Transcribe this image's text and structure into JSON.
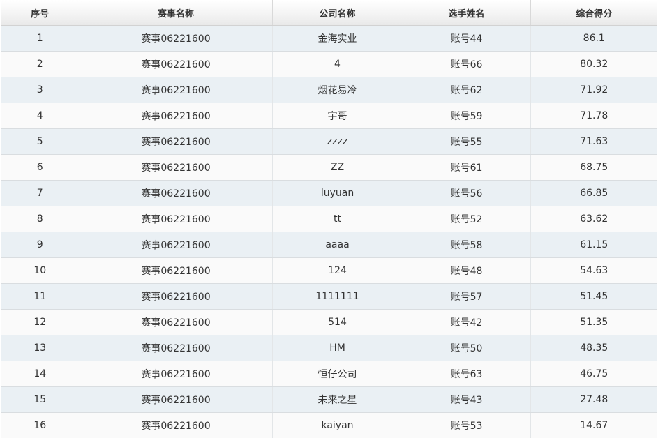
{
  "table": {
    "columns": [
      "序号",
      "赛事名称",
      "公司名称",
      "选手姓名",
      "综合得分"
    ],
    "rows": [
      [
        "1",
        "赛事06221600",
        "金海实业",
        "账号44",
        "86.1"
      ],
      [
        "2",
        "赛事06221600",
        "4",
        "账号66",
        "80.32"
      ],
      [
        "3",
        "赛事06221600",
        "烟花易冷",
        "账号62",
        "71.92"
      ],
      [
        "4",
        "赛事06221600",
        "宇哥",
        "账号59",
        "71.78"
      ],
      [
        "5",
        "赛事06221600",
        "zzzz",
        "账号55",
        "71.63"
      ],
      [
        "6",
        "赛事06221600",
        "ZZ",
        "账号61",
        "68.75"
      ],
      [
        "7",
        "赛事06221600",
        "luyuan",
        "账号56",
        "66.85"
      ],
      [
        "8",
        "赛事06221600",
        "tt",
        "账号52",
        "63.62"
      ],
      [
        "9",
        "赛事06221600",
        "aaaa",
        "账号58",
        "61.15"
      ],
      [
        "10",
        "赛事06221600",
        "124",
        "账号48",
        "54.63"
      ],
      [
        "11",
        "赛事06221600",
        "1111111",
        "账号57",
        "51.45"
      ],
      [
        "12",
        "赛事06221600",
        "514",
        "账号42",
        "51.35"
      ],
      [
        "13",
        "赛事06221600",
        "HM",
        "账号50",
        "48.35"
      ],
      [
        "14",
        "赛事06221600",
        "恒仔公司",
        "账号63",
        "46.75"
      ],
      [
        "15",
        "赛事06221600",
        "未来之星",
        "账号43",
        "27.48"
      ],
      [
        "16",
        "赛事06221600",
        "kaiyan",
        "账号53",
        "14.67"
      ]
    ]
  }
}
